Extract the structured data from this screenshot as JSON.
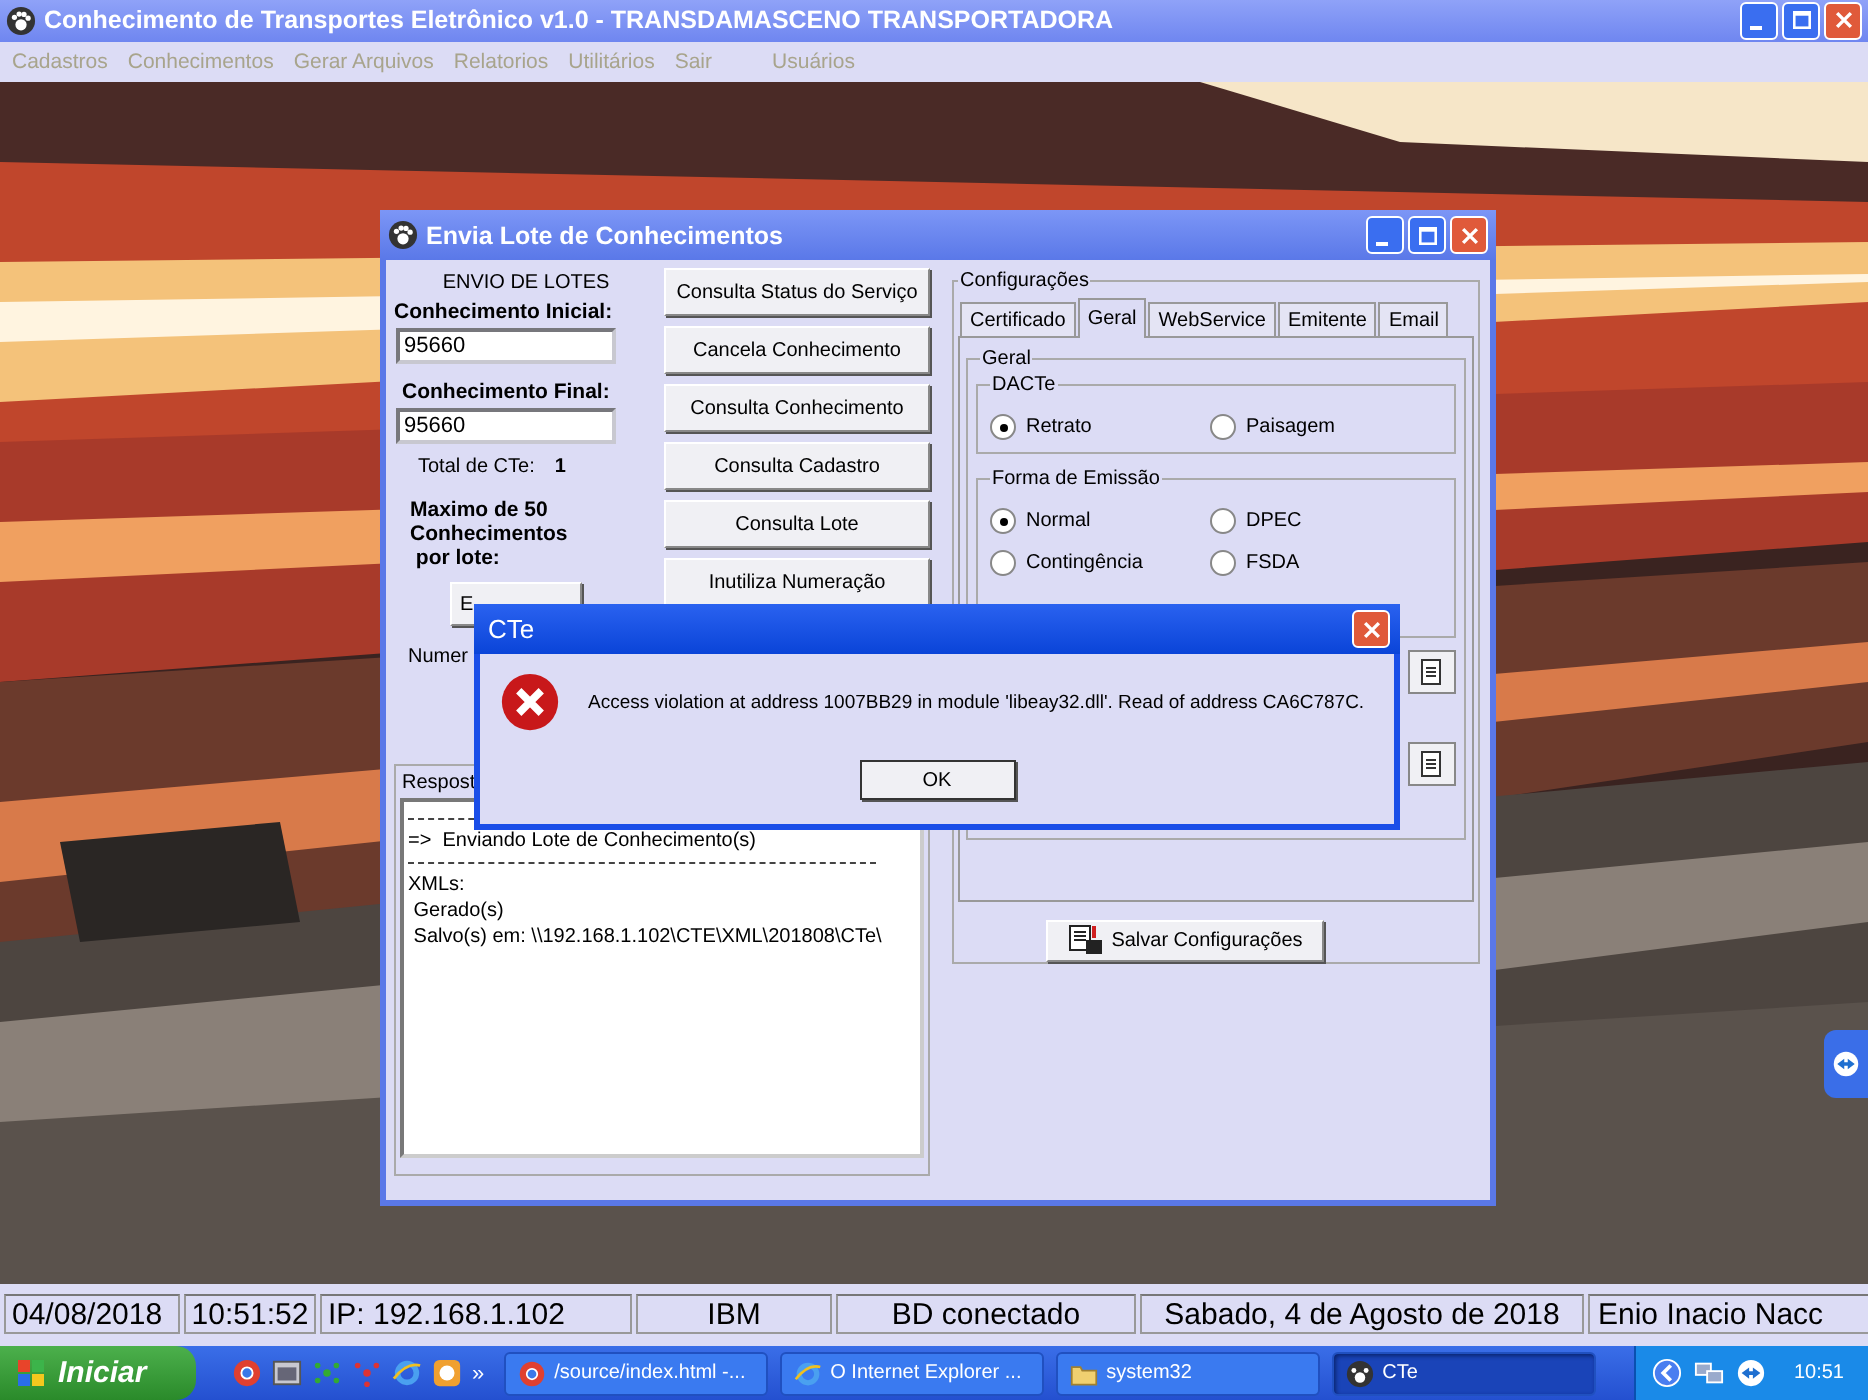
{
  "window": {
    "title": "Conhecimento de Transportes Eletrônico v1.0 - TRANSDAMASCENO TRANSPORTADORA",
    "menu": [
      {
        "label": "Cadastros",
        "disabled": true
      },
      {
        "label": "Conhecimentos",
        "disabled": true
      },
      {
        "label": "Gerar Arquivos",
        "disabled": true
      },
      {
        "label": "Relatorios",
        "disabled": true
      },
      {
        "label": "Utilitários",
        "disabled": true
      },
      {
        "label": "Sair",
        "disabled": true
      },
      {
        "label": "Usuários",
        "disabled": true
      }
    ]
  },
  "dialog": {
    "title": "Envia Lote de Conhecimentos",
    "heading": "ENVIO DE LOTES",
    "initial_label": "Conhecimento Inicial:",
    "initial_value": "95660",
    "final_label": "Conhecimento Final:",
    "final_value": "95660",
    "total_label": "Total de CTe:",
    "total_value": "1",
    "max_note": [
      "Maximo de 50",
      "Conhecimentos",
      " por lote:"
    ],
    "send_button": "E",
    "number_label": "Numer",
    "actions": [
      "Consulta Status do Serviço",
      "Cancela Conhecimento",
      "Consulta Conhecimento",
      "Consulta Cadastro",
      "Consulta Lote",
      "Inutiliza Numeração"
    ],
    "response_label": "Respost",
    "response_lines": [
      {
        "kind": "rule"
      },
      {
        "kind": "text",
        "text": "=>  Enviando Lote de Conhecimento(s)"
      },
      {
        "kind": "rule"
      },
      {
        "kind": "text",
        "text": "XMLs:"
      },
      {
        "kind": "text",
        "text": " Gerado(s)"
      },
      {
        "kind": "text",
        "text": " Salvo(s) em: \\\\192.168.1.102\\CTE\\XML\\201808\\CTe\\"
      }
    ],
    "config": {
      "title": "Configurações",
      "tabs": [
        {
          "label": "Certificado",
          "selected": false
        },
        {
          "label": "Geral",
          "selected": true
        },
        {
          "label": "WebService",
          "selected": false
        },
        {
          "label": "Emitente",
          "selected": false
        },
        {
          "label": "Email",
          "selected": false
        }
      ],
      "group_title": "Geral",
      "dacte": {
        "title": "DACTe",
        "options": [
          {
            "label": "Retrato",
            "selected": true
          },
          {
            "label": "Paisagem",
            "selected": false
          }
        ]
      },
      "emission": {
        "title": "Forma de Emissão",
        "options": [
          {
            "label": "Normal",
            "selected": true
          },
          {
            "label": "DPEC",
            "selected": false
          },
          {
            "label": "Contingência",
            "selected": false
          },
          {
            "label": "FSDA",
            "selected": false
          }
        ]
      },
      "save_button": "Salvar Configurações"
    }
  },
  "error_dialog": {
    "title": "CTe",
    "message": "Access violation at address 1007BB29 in module 'libeay32.dll'. Read of address CA6C787C.",
    "ok": "OK"
  },
  "status_bar": [
    "04/08/2018",
    "10:51:52",
    "IP: 192.168.1.102",
    "IBM",
    "BD conectado",
    "Sabado, 4 de Agosto de 2018",
    "Enio Inacio Nacc"
  ],
  "taskbar": {
    "start": "Iniciar",
    "quick_more": "»",
    "tasks": [
      {
        "label": "/source/index.html -...",
        "selected": false
      },
      {
        "label": "O Internet Explorer ...",
        "selected": false
      },
      {
        "label": "system32",
        "selected": false
      },
      {
        "label": "CTe",
        "selected": true
      }
    ],
    "clock": "10:51"
  }
}
